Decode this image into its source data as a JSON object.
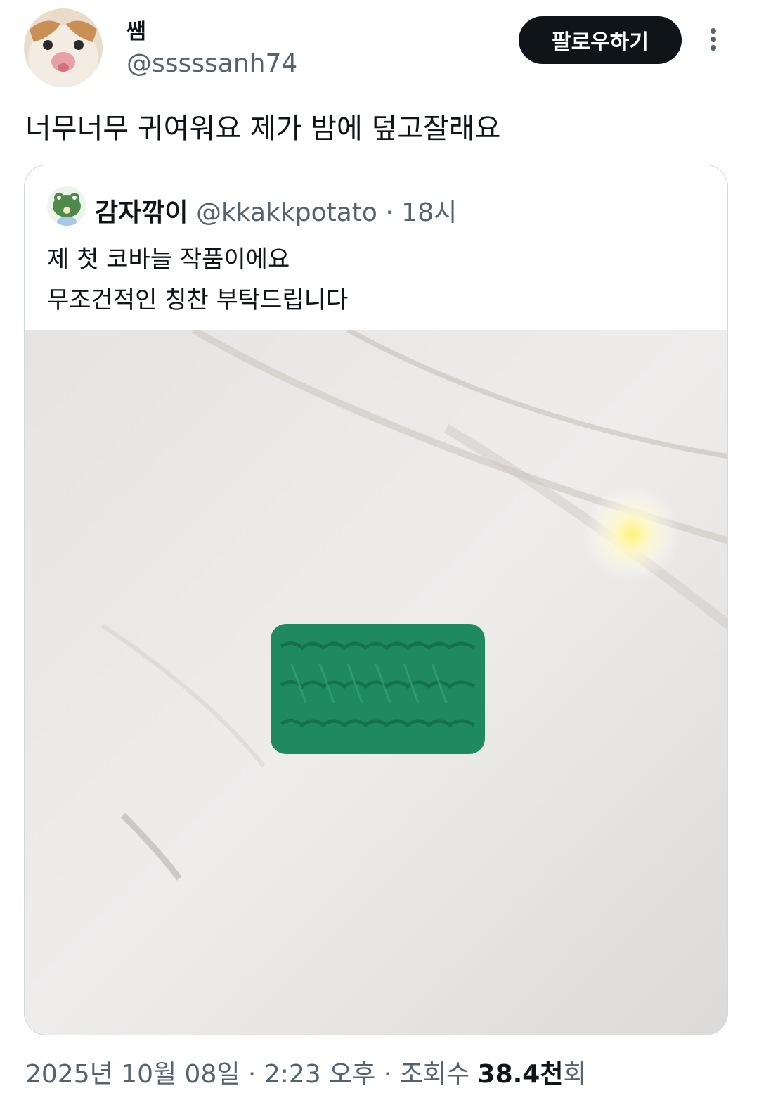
{
  "author": {
    "display_name": "쌤",
    "handle": "@sssssanh74",
    "avatar_icon": "cat-face-avatar"
  },
  "actions": {
    "follow_label": "팔로우하기",
    "more_icon": "more-vertical-icon"
  },
  "tweet": {
    "text": "너무너무 귀여워요 제가 밤에 덮고잘래요"
  },
  "quoted": {
    "display_name": "감자깎이",
    "handle": "@kkakkpotato",
    "separator": " · ",
    "time": "18시",
    "lines": [
      "제 첫 코바늘 작품이에요",
      "무조건적인 칭찬 부탁드립니다"
    ],
    "media_icon": "green-crochet-swatch-photo"
  },
  "footer": {
    "date": "2025년 10월 08일",
    "separator": " · ",
    "time": "2:23 오후",
    "views_label": "조회수 ",
    "views_count": "38.4천",
    "views_suffix": "회"
  },
  "colors": {
    "text": "#0f1419",
    "secondary": "#536471",
    "border": "#cfd9de",
    "yarn_green": "#1f8a5e"
  }
}
